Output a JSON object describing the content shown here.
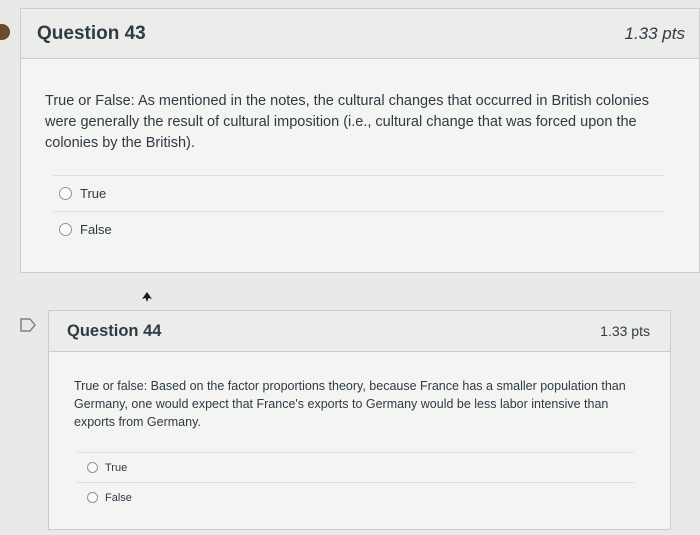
{
  "questions": [
    {
      "title": "Question 43",
      "points": "1.33 pts",
      "text": "True or False: As mentioned in the notes, the cultural changes that occurred in British colonies were generally the result of cultural imposition (i.e., cultural change that was forced upon the colonies by the British).",
      "answers": [
        {
          "label": "True",
          "selected": false
        },
        {
          "label": "False",
          "selected": false
        }
      ]
    },
    {
      "title": "Question 44",
      "points": "1.33 pts",
      "text": "True or false: Based on the factor proportions theory, because France has a smaller population than Germany, one would expect that France's exports to Germany would be less labor intensive than exports from Germany.",
      "answers": [
        {
          "label": "True",
          "selected": false
        },
        {
          "label": "False",
          "selected": false
        }
      ]
    }
  ],
  "colors": {
    "background": "#e9e9e7",
    "card": "#f4f4f2",
    "header": "#ececea",
    "border": "#c7cdd1",
    "text": "#2d3b45",
    "flag": "#6b4b2a"
  },
  "icons": {
    "flag_marker": "flag-marker-icon",
    "bookmark": "bookmark-icon",
    "cursor": "mouse-cursor-icon"
  }
}
